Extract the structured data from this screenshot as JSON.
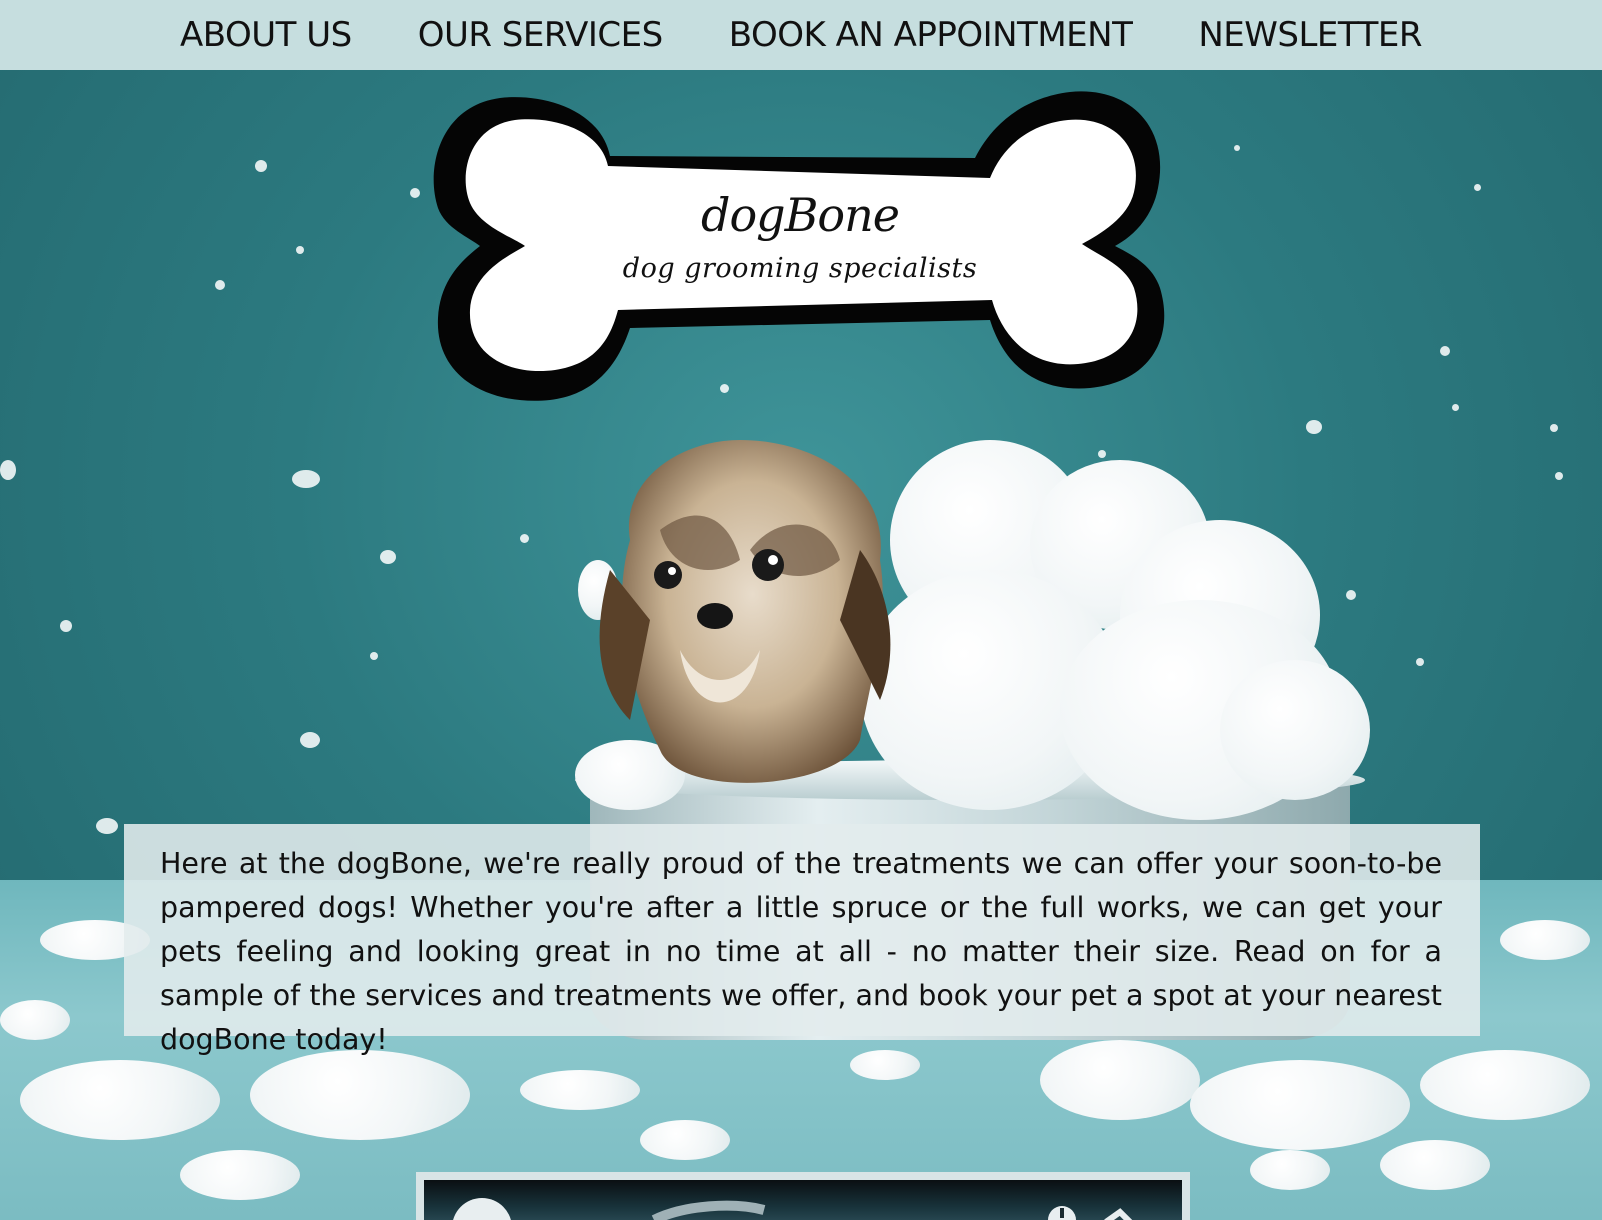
{
  "nav": {
    "items": [
      {
        "label": "ABOUT US"
      },
      {
        "label": "OUR SERVICES"
      },
      {
        "label": "BOOK AN APPOINTMENT"
      },
      {
        "label": "NEWSLETTER"
      }
    ]
  },
  "logo": {
    "name": "dogBone",
    "tagline": "dog grooming specialists"
  },
  "intro": {
    "text": "Here at the dogBone, we're really proud of the treatments we can offer your soon-to-be pampered dogs! Whether you're after a little spruce or the full works, we can get your pets feeling and looking great in no time at all - no matter their size. Read on for a sample of the services and treatments we offer, and book your pet a spot at your nearest dogBone today!"
  },
  "colors": {
    "nav_background": "#c6dedf",
    "backdrop_teal": "#2c7a80",
    "intro_background": "#e2ecedE0"
  }
}
